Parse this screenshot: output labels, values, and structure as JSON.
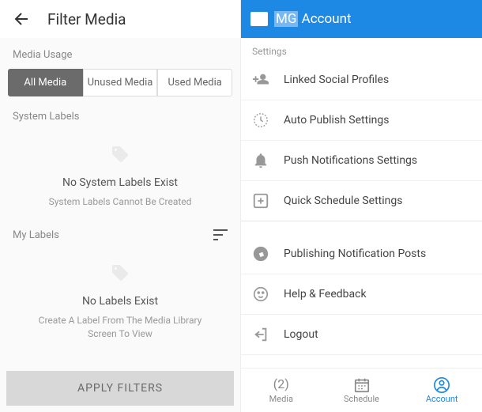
{
  "left": {
    "title": "Filter Media",
    "mediaUsageLabel": "Media Usage",
    "tabs": {
      "all": "All Media",
      "unused": "Unused Media",
      "used": "Used Media"
    },
    "systemLabels": {
      "title": "System Labels",
      "emptyTitle": "No System Labels Exist",
      "emptySubtitle": "System Labels Cannot Be Created"
    },
    "myLabels": {
      "title": "My Labels",
      "emptyTitle": "No Labels Exist",
      "emptySubtitle": "Create A Label From The Media Library Screen To View"
    },
    "applyButton": "APPLY FILTERS"
  },
  "right": {
    "titlePrefix": "MG",
    "titleRest": " Account",
    "settingsLabel": "Settings",
    "items": {
      "linked": "Linked Social Profiles",
      "autopublish": "Auto Publish Settings",
      "push": "Push Notifications Settings",
      "quick": "Quick Schedule Settings",
      "publishing": "Publishing Notification Posts",
      "help": "Help & Feedback",
      "logout": "Logout"
    },
    "nav": {
      "media": "Media",
      "mediaCount": "(2)",
      "schedule": "Schedule",
      "account": "Account"
    }
  }
}
